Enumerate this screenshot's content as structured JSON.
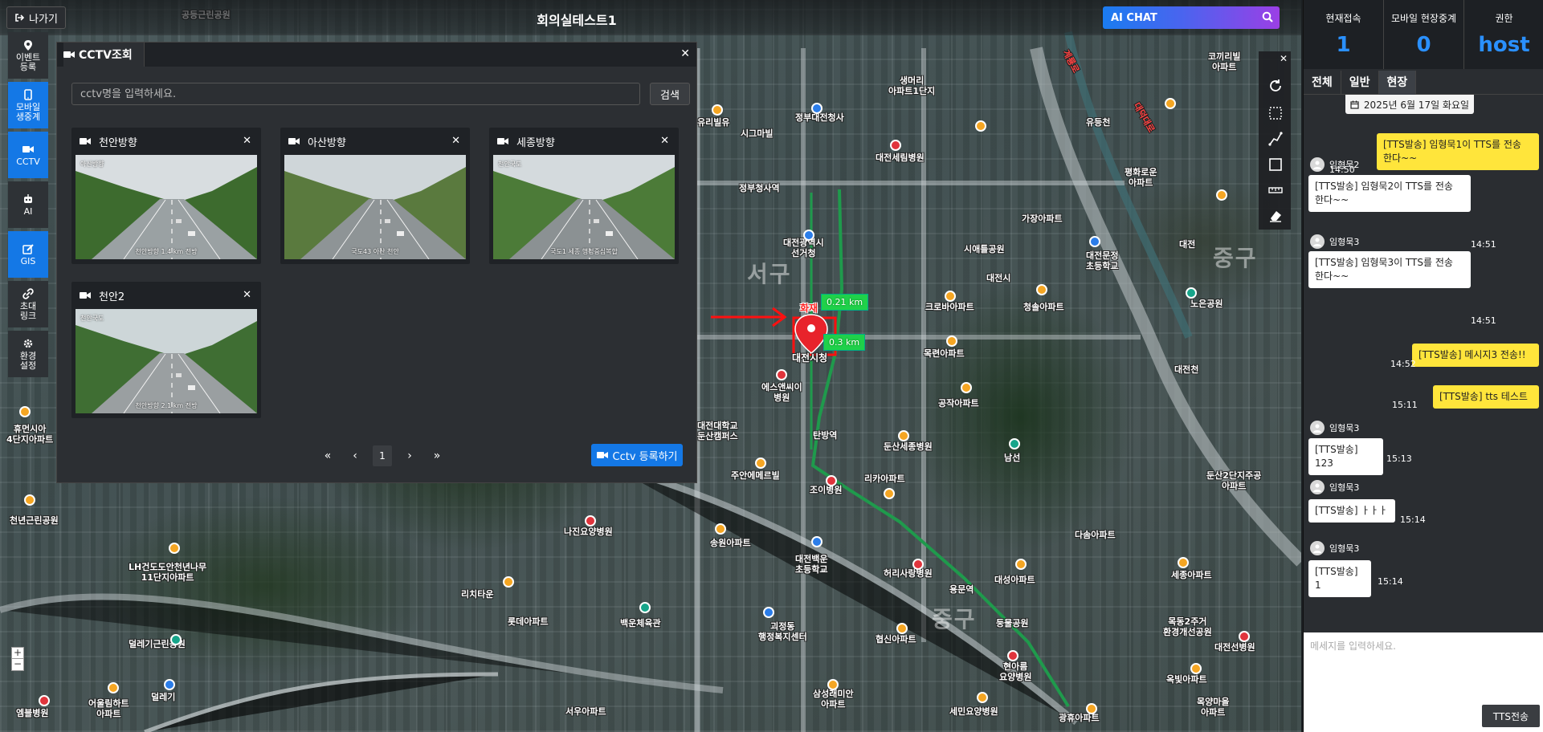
{
  "topbar": {
    "exit_label": "나가기",
    "room_title": "회의실테스트1",
    "ai_chat_label": "AI CHAT"
  },
  "nav": [
    {
      "key": "event",
      "label_l1": "이벤트",
      "label_l2": "등록",
      "icon": "map-pin-icon",
      "active": false
    },
    {
      "key": "mobile",
      "label_l1": "모바일",
      "label_l2": "생중계",
      "icon": "mobile-icon",
      "active": true
    },
    {
      "key": "cctv",
      "label_l1": "CCTV",
      "label_l2": "",
      "icon": "video-camera-icon",
      "active": true
    },
    {
      "key": "ai",
      "label_l1": "AI",
      "label_l2": "",
      "icon": "robot-icon",
      "active": false
    },
    {
      "key": "gis",
      "label_l1": "GIS",
      "label_l2": "",
      "icon": "edit-icon",
      "active": true
    },
    {
      "key": "invite",
      "label_l1": "초대",
      "label_l2": "링크",
      "icon": "link-icon",
      "active": false
    },
    {
      "key": "settings",
      "label_l1": "환경",
      "label_l2": "설정",
      "icon": "gear-icon",
      "active": false
    }
  ],
  "cctv": {
    "tab_title": "CCTV조회",
    "search_placeholder": "cctv명을 입력하세요.",
    "search_button": "검색",
    "cameras": [
      {
        "name": "천안방향",
        "top_left": "아산방향",
        "caption": "천안방향 1.4 km 전방"
      },
      {
        "name": "아산방향",
        "top_left": "",
        "caption": "국도43 아산 천안"
      },
      {
        "name": "세종방향",
        "top_left": "천안국도",
        "caption": "국도1 세종 행정중심복합"
      },
      {
        "name": "천안2",
        "top_left": "천안국도",
        "caption": "천안방향 2.1 km 전방"
      }
    ],
    "pager": {
      "first": "«",
      "prev": "‹",
      "current": "1",
      "next": "›",
      "last": "»"
    },
    "register_button": "Cctv 등록하기"
  },
  "map": {
    "marker_label": "대전시청",
    "fire_label": "화재",
    "distance_1": "0.21 km",
    "distance_2": "0.3 km",
    "labels": [
      {
        "text": "정부대전청사"
      },
      {
        "text": "생머리\n아파트1단지"
      },
      {
        "text": "시그마빌"
      },
      {
        "text": "대전세림병원"
      },
      {
        "text": "정부청사역"
      },
      {
        "text": "가장아파트"
      },
      {
        "text": "대전광역시\n선거청"
      },
      {
        "text": "시애틀공원"
      },
      {
        "text": "대전문정\n초등학교"
      },
      {
        "text": "크로바아파트"
      },
      {
        "text": "청솔아파트"
      },
      {
        "text": "목련아파트"
      },
      {
        "text": "에스앤씨이\n병원"
      },
      {
        "text": "공작아파트"
      },
      {
        "text": "대전대학교\n둔산캠퍼스"
      },
      {
        "text": "탄방역"
      },
      {
        "text": "둔산세종병원"
      },
      {
        "text": "남선"
      },
      {
        "text": "주안에메르빌"
      },
      {
        "text": "조이병원"
      },
      {
        "text": "리카아파트"
      },
      {
        "text": "둔산2단지주공\n아파트"
      },
      {
        "text": "다솜아파트"
      },
      {
        "text": "나진요양병원"
      },
      {
        "text": "송원아파트"
      },
      {
        "text": "대전백운\n초등학교"
      },
      {
        "text": "허리사랑병원"
      },
      {
        "text": "대성아파트"
      },
      {
        "text": "용문역"
      },
      {
        "text": "세종아파트"
      },
      {
        "text": "LH건도도안천년나무\n11단지아파트"
      },
      {
        "text": "리치타운"
      },
      {
        "text": "롯데아파트"
      },
      {
        "text": "백운체육관"
      },
      {
        "text": "괴정동\n행정복지센터"
      },
      {
        "text": "협신아파트"
      },
      {
        "text": "덜레기근린공원"
      },
      {
        "text": "현아름\n요양병원"
      },
      {
        "text": "목동2주거\n환경개선공원"
      },
      {
        "text": "대전선병원"
      },
      {
        "text": "옥빛아파트"
      },
      {
        "text": "서우아파트"
      },
      {
        "text": "삼성래미안\n아파트"
      },
      {
        "text": "세민요양병원"
      },
      {
        "text": "광휴아파트"
      },
      {
        "text": "어울림하트\n아파트"
      },
      {
        "text": "덜레기"
      },
      {
        "text": "엠블병원"
      },
      {
        "text": "휴먼시아\n4단지아파트"
      },
      {
        "text": "천년근린공원"
      },
      {
        "text": "노은공원"
      },
      {
        "text": "평화로운\n아파트"
      },
      {
        "text": "유등천"
      },
      {
        "text": "대전천"
      },
      {
        "text": "대전"
      },
      {
        "text": "둥물공원"
      },
      {
        "text": "공등근린공원"
      },
      {
        "text": "코끼리빌\n아파트"
      },
      {
        "text": "유리빌유"
      },
      {
        "text": "목양마을\n아파트"
      },
      {
        "text": "대전시"
      }
    ],
    "districts": [
      "서구",
      "중구",
      "중구"
    ],
    "road_labels": [
      "계룡로",
      "대덕대로"
    ]
  },
  "sidebar": {
    "stats": [
      {
        "label": "현재접속",
        "value": "1"
      },
      {
        "label": "모바일 현장중계",
        "value": "0"
      },
      {
        "label": "권한",
        "value": "host"
      }
    ],
    "tabs": [
      "전체",
      "일반",
      "현장"
    ],
    "active_tab": 2,
    "date": "2025년 6월 17일 화요일",
    "messages": [
      {
        "dir": "out",
        "text_l1": "[TTS발송] 임형묵1이 TTS를 전송",
        "text_l2": "한다~~",
        "time": "14:50"
      },
      {
        "dir": "in",
        "sender": "임형묵2",
        "text_l1": "[TTS발송] 임형묵2이 TTS를 전송",
        "text_l2": "한다~~",
        "time": "14:51"
      },
      {
        "dir": "in",
        "sender": "임형묵3",
        "text_l1": "[TTS발송] 임형묵3이 TTS를 전송",
        "text_l2": "한다~~",
        "time": "14:51"
      },
      {
        "dir": "out",
        "text_l1": "[TTS발송] 메시지3 전송!!",
        "text_l2": "",
        "time": "14:52"
      },
      {
        "dir": "out",
        "text_l1": "[TTS발송] tts 테스트",
        "text_l2": "",
        "time": "15:11"
      },
      {
        "dir": "in",
        "sender": "임형묵3",
        "text_l1": "[TTS발송] 123",
        "text_l2": "",
        "time": "15:13"
      },
      {
        "dir": "in",
        "sender": "임형묵3",
        "text_l1": "[TTS발송] ㅏㅏㅏ",
        "text_l2": "",
        "time": "15:14"
      },
      {
        "dir": "in",
        "sender": "임형묵3",
        "text_l1": "[TTS발송] 1",
        "text_l2": "",
        "time": "15:14"
      }
    ],
    "input_placeholder": "메세지를 입력하세요.",
    "tts_button": "TTS전송"
  }
}
